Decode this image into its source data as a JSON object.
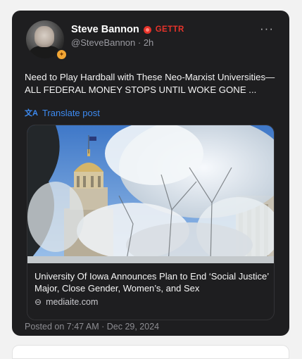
{
  "post": {
    "author_name": "Steve Bannon",
    "platform": "GETTR",
    "handle_time": "@SteveBannon · 2h",
    "more_label": "···",
    "text": "Need to Play Hardball with These Neo-Marxist Universities—ALL FEDERAL MONEY STOPS UNTIL WOKE GONE ...",
    "translate_label": "Translate post",
    "posted": "Posted on 7:47 AM · Dec 29, 2024"
  },
  "link_card": {
    "title": "University Of Iowa Announces Plan to End ‘Social Justice’ Major, Close Gender, Women’s, and Sex",
    "domain": "mediaite.com"
  },
  "colors": {
    "card_bg": "#1e1e20",
    "page_bg": "#f2f2f2",
    "link_blue": "#3d8bf2",
    "gettr_red": "#e6332a",
    "muted_text": "#8d8d92"
  },
  "icons": {
    "more": "more-dots-icon",
    "translate": "translate-icon",
    "link": "link-chain-icon",
    "platform": "gettr-logo-icon",
    "badge": "verified-badge-icon"
  }
}
